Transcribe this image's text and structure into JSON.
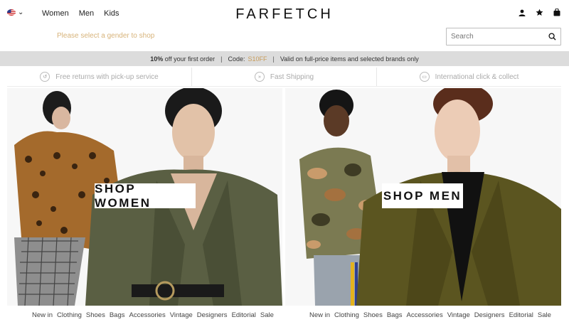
{
  "header": {
    "logo": "FARFETCH",
    "locale_flag": "us-flag-icon",
    "gender_nav": [
      "Women",
      "Men",
      "Kids"
    ],
    "gender_prompt": "Please select a gender to shop",
    "search": {
      "placeholder": "Search"
    },
    "icons": [
      "account-icon",
      "wishlist-star-icon",
      "bag-icon",
      "search-icon"
    ]
  },
  "promo": {
    "percent": "10%",
    "offer_text": "off your first order",
    "code_label": "Code:",
    "code": "S10FF",
    "terms": "Valid on full-price items and selected brands only"
  },
  "benefits": [
    {
      "label": "Free returns with pick-up service",
      "icon": "returns-icon"
    },
    {
      "label": "Fast Shipping",
      "icon": "shipping-icon"
    },
    {
      "label": "International click & collect",
      "icon": "collect-icon"
    }
  ],
  "hero": {
    "women": {
      "cta": "SHOP WOMEN"
    },
    "men": {
      "cta": "SHOP MEN"
    }
  },
  "subnav": {
    "women": [
      "New in",
      "Clothing",
      "Shoes",
      "Bags",
      "Accessories",
      "Vintage",
      "Designers",
      "Editorial",
      "Sale"
    ],
    "men": [
      "New in",
      "Clothing",
      "Shoes",
      "Bags",
      "Accessories",
      "Vintage",
      "Designers",
      "Editorial",
      "Sale"
    ]
  },
  "colors": {
    "promo_bg": "#dcdcdc",
    "accent_gold": "#c79b58",
    "prompt_gold": "#d7b37a"
  }
}
